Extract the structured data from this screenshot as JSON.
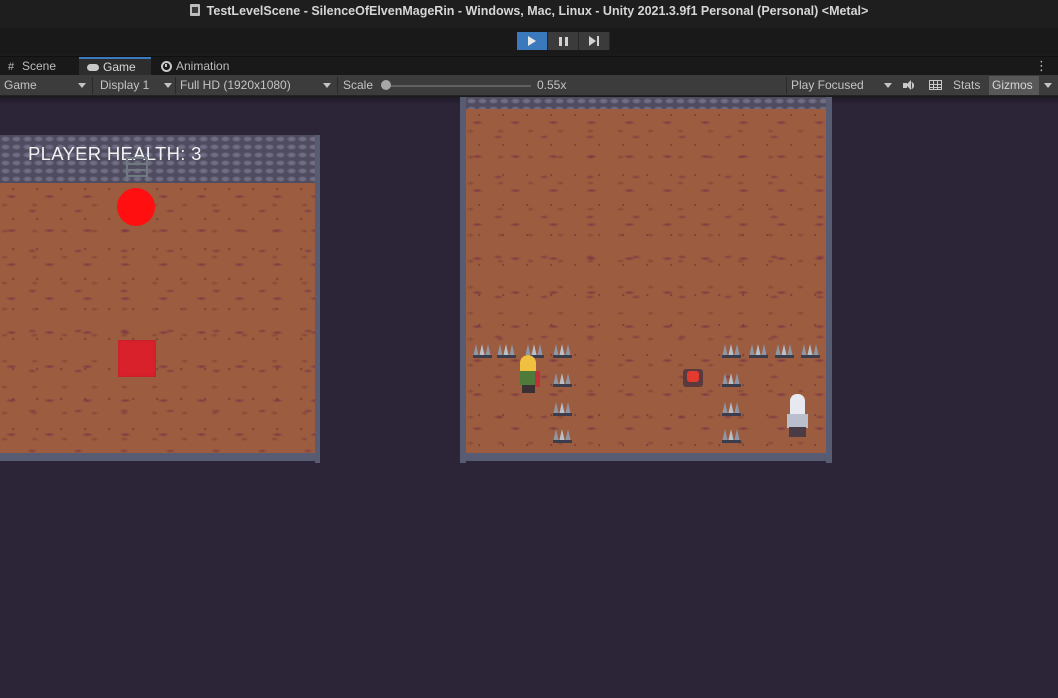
{
  "window": {
    "title": "TestLevelScene - SilenceOfElvenMageRin - Windows, Mac, Linux - Unity 2021.3.9f1 Personal (Personal) <Metal>"
  },
  "play_controls": {
    "play_icon": "play-icon",
    "pause_icon": "pause-icon",
    "step_icon": "step-icon",
    "play_active": true
  },
  "tabs": [
    {
      "label": "Scene",
      "icon": "hash-icon"
    },
    {
      "label": "Game",
      "icon": "gamepad-icon",
      "selected": true
    },
    {
      "label": "Animation",
      "icon": "clock-icon"
    }
  ],
  "toolbar": {
    "view_dropdown": "Game",
    "display_dropdown": "Display 1",
    "resolution_dropdown": "Full HD (1920x1080)",
    "scale_label": "Scale",
    "scale_value": "0.55x",
    "play_mode_dropdown": "Play Focused",
    "audio_icon": "speaker-icon",
    "layout_icon": "grid-icon",
    "stats_label": "Stats",
    "gizmos_label": "Gizmos",
    "more_icon": "kebab-menu-icon"
  },
  "game": {
    "hud": {
      "player_health_label": "PLAYER HEALTH:  3"
    },
    "colors": {
      "background": "#2c2538",
      "dirt": "#9b5c3f",
      "wall": "#585c73",
      "orb": "#ff0f0f",
      "square": "#d8212a"
    },
    "objects": [
      "ladder",
      "red-orb",
      "red-square",
      "spike-traps",
      "pressure-button",
      "player-sprite",
      "ghost-enemy"
    ]
  }
}
